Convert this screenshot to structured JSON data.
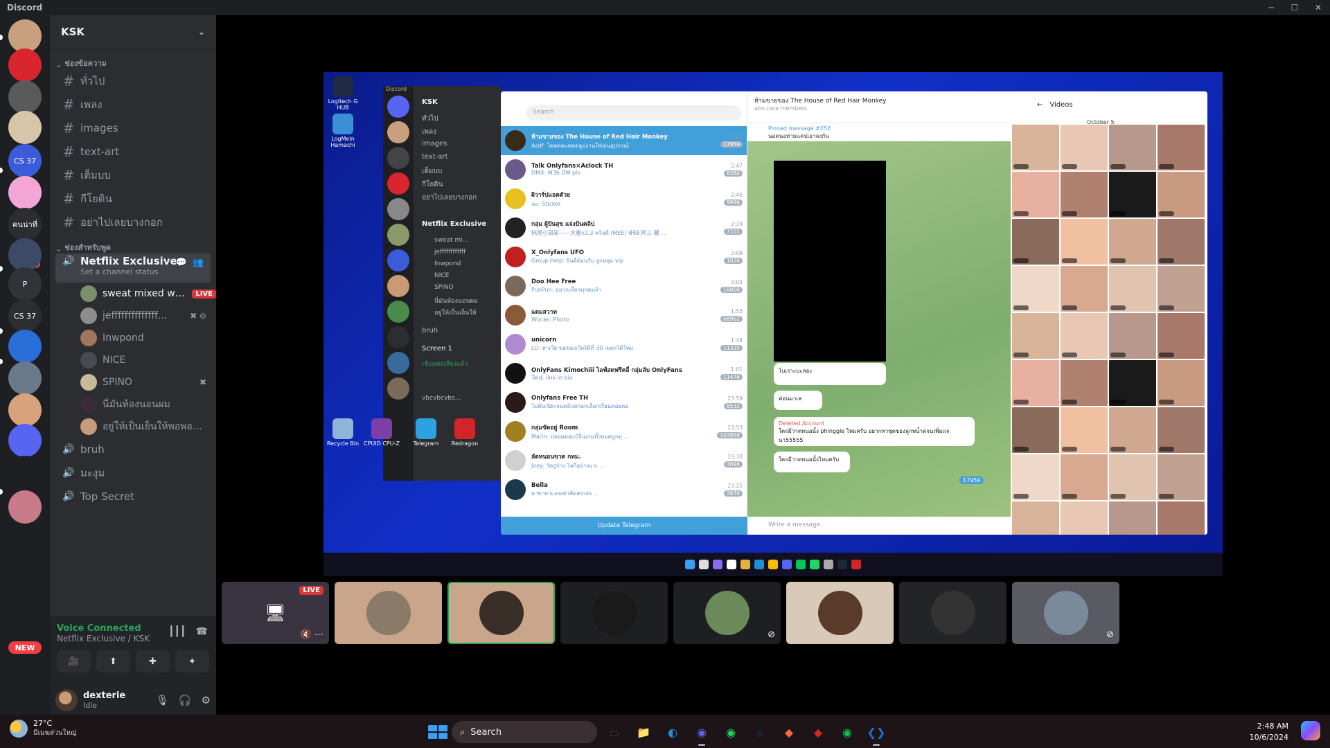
{
  "window": {
    "title": "Discord",
    "controls": [
      "─",
      "☐",
      "✕"
    ]
  },
  "rail": {
    "servers": [
      {
        "icon": "avatar-server-icon",
        "color": "#c8a07d"
      },
      {
        "icon": "red-server-icon",
        "color": "#d9252e"
      },
      {
        "icon": "scribble-server-icon",
        "color": "#5a5a5a"
      },
      {
        "icon": "dog-server-icon",
        "color": "#d8c4a8"
      },
      {
        "label": "CS 37",
        "color": "#3b5bd8"
      },
      {
        "icon": "pink-ghost-server-icon",
        "color": "#f3a6d6"
      },
      {
        "label": "คนน่าที่",
        "color": "#2b2d31"
      },
      {
        "icon": "fox-server-icon",
        "color": "#3c4a66",
        "badge": "57"
      },
      {
        "label": "P",
        "color": "#313338"
      },
      {
        "label": "CS 37",
        "color": "#2b2d31"
      },
      {
        "icon": "globe-server-icon",
        "color": "#2a6fd8"
      },
      {
        "icon": "anime-server-icon",
        "color": "#6a7a8c"
      },
      {
        "icon": "face-server-icon",
        "color": "#d8a27a"
      },
      {
        "icon": "folder-server-icon",
        "color": "#5865f2"
      },
      {
        "icon": "headphones-server-icon",
        "color": "#1e1f22"
      },
      {
        "icon": "hands-server-icon",
        "color": "#c97a8a"
      }
    ],
    "new_label": "NEW"
  },
  "sidebar": {
    "guild_name": "KSK",
    "text_category": "ช่องข้อความ",
    "text_channels": [
      "ทั่วไป",
      "เพลง",
      "images",
      "text-art",
      "เต็มบบ",
      "กีโยดิน",
      "อย่าไปเลยบางกอก"
    ],
    "voice_category": "ช่องสำหรับพูด",
    "active_voice": {
      "name": "Netflix Exclusive",
      "status": "Set a channel status"
    },
    "voice_users": [
      {
        "name": "sweat mixed wi...",
        "live": "LIVE",
        "color": "#7c8f6b",
        "bright": true
      },
      {
        "name": "jeffffffffffffff...",
        "color": "#8d8d8d",
        "icons": "✖ ⊘"
      },
      {
        "name": "Inwpond",
        "color": "#a0775a"
      },
      {
        "name": "NICE",
        "color": "#4a4a52"
      },
      {
        "name": "SPINO",
        "color": "#c9b99b",
        "icons": "✖"
      },
      {
        "name": "นี่มันห้องนอนผม",
        "color": "#3c2c3a"
      },
      {
        "name": "อยู่ให้เป็นเย็นให้พอพอมี...",
        "color": "#c79a7a"
      }
    ],
    "voice_channels": [
      "bruh",
      "มะงุม",
      "Top Secret"
    ]
  },
  "voice_panel": {
    "connected": "Voice Connected",
    "location": "Netflix Exclusive / KSK",
    "buttons": [
      "🎥",
      "⬆",
      "✚",
      "✦"
    ]
  },
  "user": {
    "name": "dexterie",
    "status": "Idle"
  },
  "stream": {
    "desktop_icons": [
      {
        "label": "Logitech G HUB",
        "color": "#1f2a44"
      },
      {
        "label": "LogMeIn Hamachi",
        "color": "#3b8fd6"
      },
      {
        "label": "Recycle Bin",
        "color": "#8fb4d9"
      },
      {
        "label": "CPUID CPU-Z",
        "color": "#7c3fa8"
      },
      {
        "label": "Telegram",
        "color": "#2aa3e0"
      },
      {
        "label": "Redragon",
        "color": "#d0262a"
      }
    ],
    "inner_discord": {
      "title": "Discord",
      "guild": "KSK",
      "channels": [
        "ทั่วไป",
        "เพลง",
        "images",
        "text-art",
        "เต็มบบ",
        "กีโยดิน",
        "อย่าไปเลยบางกอก"
      ],
      "voice": "Netflix Exclusive",
      "users": [
        "sweat mi...",
        "jeffffffffffff",
        "Inwpond",
        "NICE",
        "SPINO",
        "นี่มันห้องนอนผม",
        "อยู่ให้เป็นเย็นให้"
      ],
      "bruh": "bruh",
      "screen": "Screen 1",
      "connected": "เชื่อมต่อเสียงแล้ว",
      "username": "vbcvbcvbs..."
    },
    "telegram": {
      "search": "Search",
      "chats": [
        {
          "name": "ห้ามขายของ The House of Red Hair Monkey",
          "msg": "Asdf: โดดดดแดดดลูปงานใส่เล่นอุปกรณ์",
          "time": "2:47",
          "count": "17959",
          "color": "#3a2a1a",
          "selected": true
        },
        {
          "name": "Talk Onlyfans×Aclock TH",
          "msg": "DMX: M36 DM pls",
          "time": "2:47",
          "count": "8380",
          "color": "#6a5a8a"
        },
        {
          "name": "ผิวาร์ปแอคตัวย",
          "msg": "นะ: Sticker",
          "time": "2:46",
          "count": "9996",
          "color": "#e8c020"
        },
        {
          "name": "กลุ่ม ผู้ปันสุข แจ่งปันคลิป",
          "msg": "韩国小哥哥——大量v2.3 พวิลดี (MEE) พีซีฮ์ 阿三 藏 ...",
          "time": "2:19",
          "count": "7101",
          "color": "#222"
        },
        {
          "name": "X_Onlyfans UFO",
          "msg": "Group Help: ยินดีต้อนรับ ลูกหลุม vip",
          "time": "2:06",
          "count": "1026",
          "color": "#c02020"
        },
        {
          "name": "Doo Hee Free",
          "msg": "PunPun: อยากเที่ยวทุกคนจ้า",
          "time": "2:05",
          "count": "18008",
          "color": "#7a6a5a"
        },
        {
          "name": "แดมสวาท",
          "msg": "Wucas: Photo",
          "time": "1:55",
          "count": "68962",
          "color": "#8a5a3a"
        },
        {
          "name": "unicorn",
          "msg": "LO: หาเวีย ขอของเวียงิมีที่ 30 เมตรได้ไหม",
          "time": "1:48",
          "count": "11325",
          "color": "#b08ad0"
        },
        {
          "name": "OnlyFans Kimochiii ไลฟ์สดฟรีคลี่ กลุ่มลับ OnlyFans",
          "msg": "Teld: link in bio",
          "time": "1:01",
          "count": "11476",
          "color": "#111"
        },
        {
          "name": "Onlyfans Free TH",
          "msg": "ไม่คันเปิดเจนคลิปลกอกเลือกเรียนคอยคอ",
          "time": "23:59",
          "count": "8532",
          "color": "#2a1a1a"
        },
        {
          "name": "กลุ่มขัดอยู่ Room",
          "msg": "Marin: ปลอมต่อแบ้จีนเกมทั้งหมดถูกตุ ...",
          "time": "23:53",
          "count": "103858",
          "color": "#a08020"
        },
        {
          "name": "ลัดหนอนขวด กทม.",
          "msg": "Joey: วัดรูปาง ไลกีอย่างแวเ ...",
          "time": "23:30",
          "count": "3098",
          "color": "#d0d0d0"
        },
        {
          "name": "Bella",
          "msg": "ลาขายาแดนฆ่าคัดสรรค่ะ ...",
          "time": "23:25",
          "count": "2670",
          "color": "#1a3a4a"
        }
      ],
      "update": "Update Telegram",
      "chat_title": "ห้ามขายของ The House of Red Hair Monkey",
      "chat_sub": "abn.cara members",
      "pinned": "Pinned message #252",
      "pinned_text": "นอคนอห่ามแคปเอาลงกัน",
      "bubble1": "โบเราะบะลอะ",
      "bubble2": "ค่อนมาเล",
      "deleted": "Deleted Account",
      "deleted_text": "ใครมีวาดหนอนั้ง phinggle ไหมครับ อยากหาชุดของลูกพน้ำดจนเพิ่มแจนา55555",
      "bubble3": "ใครมีวาดหนอนั้งไหมครับ",
      "badge": "17959",
      "input": "Write a message...",
      "videos_title": "Videos",
      "video_month": "October 5"
    }
  },
  "tiles": [
    {
      "type": "stream",
      "live": "LIVE",
      "color": "#3a3440"
    },
    {
      "color": "#c8a58b",
      "av": "#8a7a68"
    },
    {
      "color": "#c8a58b",
      "av": "#3a2e28",
      "speaking": true
    },
    {
      "color": "#1e1f22",
      "av": "#1a1a1a"
    },
    {
      "color": "#1e1f22",
      "av": "#6a8a5a",
      "muted": true
    },
    {
      "color": "#d8c9b8",
      "av": "#5a3a28"
    },
    {
      "color": "#232428",
      "av": "#333"
    },
    {
      "color": "#5a5a62",
      "av": "#7a8a9a",
      "muted": true
    }
  ],
  "taskbar": {
    "temp": "27°C",
    "weather": "มีเมฆส่วนใหญ่",
    "search": "Search",
    "apps": [
      {
        "icon": "task-view-icon",
        "glyph": "▭",
        "color": "#3a3a3a"
      },
      {
        "icon": "file-explorer-icon",
        "glyph": "📁",
        "color": "#e8b23a"
      },
      {
        "icon": "edge-icon",
        "glyph": "◐",
        "color": "#1f8fd8"
      },
      {
        "icon": "discord-icon",
        "glyph": "◉",
        "color": "#5865f2",
        "active": true
      },
      {
        "icon": "spotify-icon",
        "glyph": "◉",
        "color": "#1ed760"
      },
      {
        "icon": "steam-icon",
        "glyph": "◈",
        "color": "#1b2838"
      },
      {
        "icon": "game-icon",
        "glyph": "◆",
        "color": "#f26a3a"
      },
      {
        "icon": "redragon-icon",
        "glyph": "◆",
        "color": "#d0262a"
      },
      {
        "icon": "line-icon",
        "glyph": "◉",
        "color": "#06c755"
      },
      {
        "icon": "vscode-icon",
        "glyph": "❮❯",
        "color": "#1f6fd8",
        "active": true
      }
    ],
    "time": "2:48 AM",
    "date": "10/6/2024"
  }
}
